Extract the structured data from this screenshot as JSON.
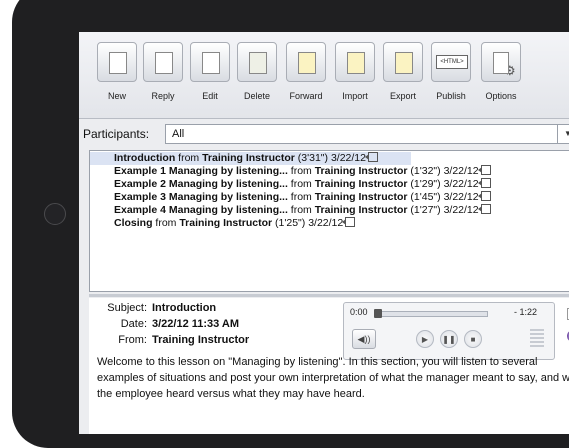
{
  "toolbar": [
    {
      "name": "new-button",
      "icon": "new-document-icon",
      "label": "New"
    },
    {
      "name": "reply-button",
      "icon": "reply-icon",
      "label": "Reply"
    },
    {
      "name": "edit-button",
      "icon": "edit-pencil-icon",
      "label": "Edit"
    },
    {
      "name": "delete-button",
      "icon": "trash-icon",
      "label": "Delete"
    },
    {
      "name": "forward-button",
      "icon": "forward-icon",
      "label": "Forward"
    },
    {
      "name": "import-button",
      "icon": "import-icon",
      "label": "Import"
    },
    {
      "name": "export-button",
      "icon": "export-icon",
      "label": "Export"
    },
    {
      "name": "publish-button",
      "icon": "html-icon",
      "label": "Publish",
      "badge": "<HTML>"
    },
    {
      "name": "options-button",
      "icon": "gear-icon",
      "label": "Options"
    }
  ],
  "participants": {
    "label": "Participants:",
    "value": "All"
  },
  "messages": [
    {
      "title": "Introduction",
      "from_word": "from",
      "author": "Training Instructor",
      "duration": "(3'31\")",
      "date": "3/22/12",
      "selected": true
    },
    {
      "title": "Example 1 Managing by listening...",
      "from_word": "from",
      "author": "Training Instructor",
      "duration": "(1'32\")",
      "date": "3/22/12",
      "selected": false
    },
    {
      "title": "Example 2 Managing by listening...",
      "from_word": "from",
      "author": "Training Instructor",
      "duration": "(1'29\")",
      "date": "3/22/12",
      "selected": false
    },
    {
      "title": "Example 3 Managing by listening...",
      "from_word": "from",
      "author": "Training Instructor",
      "duration": "(1'45\")",
      "date": "3/22/12",
      "selected": false
    },
    {
      "title": "Example 4 Managing by listening...",
      "from_word": "from",
      "author": "Training Instructor",
      "duration": "(1'27\")",
      "date": "3/22/12",
      "selected": false
    },
    {
      "title": "Closing",
      "from_word": "from",
      "author": "Training Instructor",
      "duration": "(1'25\")",
      "date": "3/22/12",
      "selected": false
    }
  ],
  "detail": {
    "subject_label": "Subject:",
    "subject": "Introduction",
    "date_label": "Date:",
    "date": "3/22/12 11:33 AM",
    "from_label": "From:",
    "from": "Training Instructor",
    "body": "Welcome to this lesson on \"Managing by listening\".  In this section, you will listen to several examples of situations and post your own interpretation of what the manager meant to say, and what the employee heard versus what they may have heard."
  },
  "player": {
    "elapsed": "0:00",
    "remaining": "- 1:22",
    "progress": 0.03
  }
}
